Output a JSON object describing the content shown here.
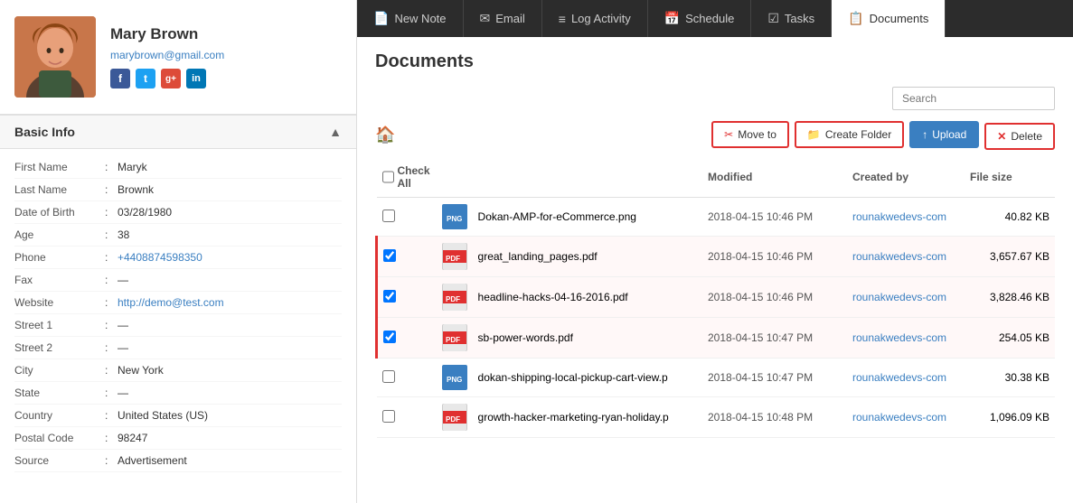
{
  "profile": {
    "name": "Mary Brown",
    "email": "marybrown@gmail.com",
    "avatar_bg": "#c87941"
  },
  "social": {
    "facebook": "f",
    "twitter": "t",
    "googleplus": "g+",
    "linkedin": "in"
  },
  "basic_info": {
    "title": "Basic Info",
    "fields": [
      {
        "label": "First Name",
        "value": "Maryk"
      },
      {
        "label": "Last Name",
        "value": "Brownk"
      },
      {
        "label": "Date of Birth",
        "value": "03/28/1980"
      },
      {
        "label": "Age",
        "value": "38"
      },
      {
        "label": "Phone",
        "value": "+4408874598350",
        "type": "link"
      },
      {
        "label": "Fax",
        "value": "—"
      },
      {
        "label": "Website",
        "value": "http://demo@test.com",
        "type": "link"
      },
      {
        "label": "Street 1",
        "value": "—"
      },
      {
        "label": "Street 2",
        "value": "—"
      },
      {
        "label": "City",
        "value": "New York"
      },
      {
        "label": "State",
        "value": "—"
      },
      {
        "label": "Country",
        "value": "United States (US)"
      },
      {
        "label": "Postal Code",
        "value": "98247"
      },
      {
        "label": "Source",
        "value": "Advertisement"
      }
    ]
  },
  "nav": {
    "items": [
      {
        "id": "new-note",
        "icon": "📄",
        "label": "New Note"
      },
      {
        "id": "email",
        "icon": "✉",
        "label": "Email"
      },
      {
        "id": "log-activity",
        "icon": "≡",
        "label": "Log Activity"
      },
      {
        "id": "schedule",
        "icon": "📅",
        "label": "Schedule"
      },
      {
        "id": "tasks",
        "icon": "☑",
        "label": "Tasks"
      },
      {
        "id": "documents",
        "icon": "📋",
        "label": "Documents",
        "active": true
      }
    ]
  },
  "documents": {
    "title": "Documents",
    "search_placeholder": "Search",
    "buttons": {
      "move_to": "Move to",
      "create_folder": "Create Folder",
      "upload": "Upload",
      "delete": "Delete"
    },
    "columns": {
      "check_all": "Check All",
      "modified": "Modified",
      "created_by": "Created by",
      "file_size": "File size"
    },
    "files": [
      {
        "id": 1,
        "name": "Dokan-AMP-for-eCommerce.png",
        "type": "png",
        "modified": "2018-04-15 10:46 PM",
        "created_by": "rounakwedevs-com",
        "size": "40.82 KB",
        "selected": false
      },
      {
        "id": 2,
        "name": "great_landing_pages.pdf",
        "type": "pdf",
        "modified": "2018-04-15 10:46 PM",
        "created_by": "rounakwedevs-com",
        "size": "3,657.67 KB",
        "selected": true
      },
      {
        "id": 3,
        "name": "headline-hacks-04-16-2016.pdf",
        "type": "pdf",
        "modified": "2018-04-15 10:46 PM",
        "created_by": "rounakwedevs-com",
        "size": "3,828.46 KB",
        "selected": true
      },
      {
        "id": 4,
        "name": "sb-power-words.pdf",
        "type": "pdf",
        "modified": "2018-04-15 10:47 PM",
        "created_by": "rounakwedevs-com",
        "size": "254.05 KB",
        "selected": true
      },
      {
        "id": 5,
        "name": "dokan-shipping-local-pickup-cart-view.p",
        "type": "png",
        "modified": "2018-04-15 10:47 PM",
        "created_by": "rounakwedevs-com",
        "size": "30.38 KB",
        "selected": false
      },
      {
        "id": 6,
        "name": "growth-hacker-marketing-ryan-holiday.p",
        "type": "pdf",
        "modified": "2018-04-15 10:48 PM",
        "created_by": "rounakwedevs-com",
        "size": "1,096.09 KB",
        "selected": false
      }
    ]
  }
}
